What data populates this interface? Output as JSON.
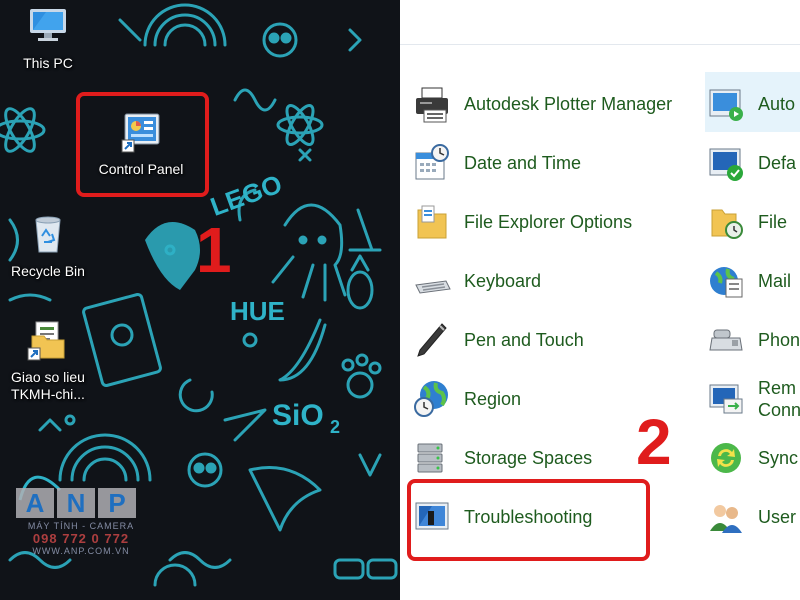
{
  "desktop": {
    "icons": [
      {
        "label": "This PC"
      },
      {
        "label": "Control Panel"
      },
      {
        "label": "Recycle Bin"
      },
      {
        "label_line1": "Giao so lieu",
        "label_line2": "TKMH-chi..."
      }
    ],
    "step1": "1",
    "wallpaper_text": {
      "lego": "LEGO",
      "hue": "HUE",
      "sio2": "SiO",
      "sio2_sub": "2"
    },
    "watermark": {
      "letters": [
        "A",
        "N",
        "P"
      ],
      "tagline": "MÁY TÍNH - CAMERA",
      "phone": "098 772 0 772",
      "web": "WWW.ANP.COM.VN"
    }
  },
  "control_panel": {
    "step2": "2",
    "column1": [
      {
        "label": "Autodesk Plotter Manager",
        "icon": "printer-icon"
      },
      {
        "label": "Date and Time",
        "icon": "calendar-clock-icon"
      },
      {
        "label": "File Explorer Options",
        "icon": "folder-options-icon"
      },
      {
        "label": "Keyboard",
        "icon": "keyboard-icon"
      },
      {
        "label": "Pen and Touch",
        "icon": "pen-icon"
      },
      {
        "label": "Region",
        "icon": "globe-clock-icon"
      },
      {
        "label": "Storage Spaces",
        "icon": "storage-drives-icon"
      },
      {
        "label": "Troubleshooting",
        "icon": "troubleshooting-icon"
      }
    ],
    "column2": [
      {
        "label": "Auto",
        "icon": "autoplay-icon"
      },
      {
        "label": "Defa",
        "icon": "default-programs-icon"
      },
      {
        "label": "File",
        "icon": "file-history-icon"
      },
      {
        "label": "Mail",
        "icon": "mail-icon"
      },
      {
        "label": "Phon",
        "icon": "phone-modem-icon"
      },
      {
        "label_line1": "Rem",
        "label_line2": "Conn",
        "icon": "remote-connection-icon"
      },
      {
        "label": "Sync",
        "icon": "sync-icon"
      },
      {
        "label": "User",
        "icon": "users-icon"
      }
    ]
  },
  "colors": {
    "highlight": "#e01c1c",
    "link_text": "#1e5b1e",
    "desktop_bg": "#101318",
    "doodle": "#2fb3c8"
  }
}
